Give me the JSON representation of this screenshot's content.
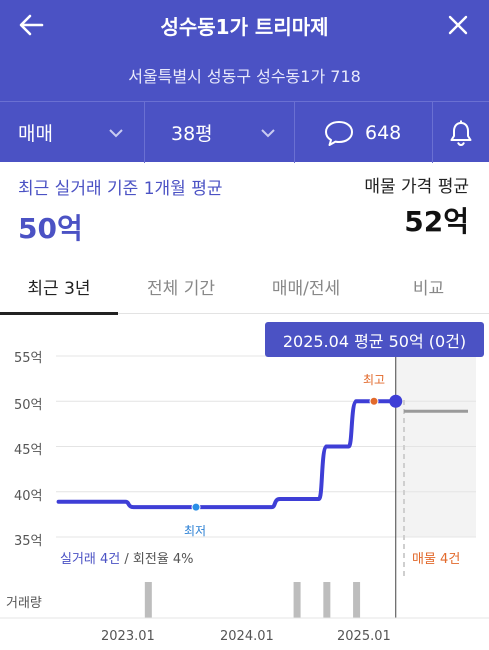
{
  "header": {
    "title": "성수동1가 트리마제",
    "address": "서울특별시 성동구 성수동1가 718",
    "back_icon": "arrow-left-icon",
    "close_icon": "close-icon"
  },
  "filters": {
    "trade_type": "매매",
    "area": "38평",
    "comments_count": "648",
    "comment_icon": "speech-bubble-icon",
    "alert_icon": "bell-icon"
  },
  "summary": {
    "recent_label": "최근 실거래 기준 1개월 평균",
    "recent_value": "50억",
    "listing_label": "매물 가격 평균",
    "listing_value": "52억"
  },
  "tabs": [
    "최근 3년",
    "전체 기간",
    "매매/전세",
    "비교"
  ],
  "active_tab": 0,
  "tooltip": "2025.04 평균 50억 (0건)",
  "chart_data": {
    "type": "line",
    "y_tick_labels": [
      "55억",
      "50억",
      "45억",
      "40억",
      "35억"
    ],
    "ylim": [
      35,
      55
    ],
    "x_tick_labels": [
      "2023.01",
      "2024.01",
      "2025.01"
    ],
    "markers": {
      "low": "최저",
      "high": "최고"
    },
    "series": [
      {
        "name": "실거래",
        "color": "#3e3ed6",
        "points": [
          [
            "2022.06",
            38.9
          ],
          [
            "2022.12",
            38.9
          ],
          [
            "2023.03",
            38.3
          ],
          [
            "2023.09",
            38.3
          ],
          [
            "2024.03",
            38.3
          ],
          [
            "2024.05",
            39.2
          ],
          [
            "2024.08",
            39.2
          ],
          [
            "2024.09",
            45.0
          ],
          [
            "2024.11",
            45.0
          ],
          [
            "2024.12",
            50.0
          ],
          [
            "2025.04",
            50.0
          ]
        ]
      },
      {
        "name": "매물",
        "color": "#9a9a9a",
        "points": [
          [
            "2025.05",
            48.9
          ],
          [
            "2025.09",
            48.9
          ]
        ]
      }
    ],
    "volume_label": "거래량",
    "volume_months": [
      "2023.03",
      "2024.06",
      "2024.09",
      "2024.12"
    ],
    "footer_left_count": "실거래 4건",
    "footer_left_rest": " / 회전율 4%",
    "footer_right": "매물 4건"
  }
}
